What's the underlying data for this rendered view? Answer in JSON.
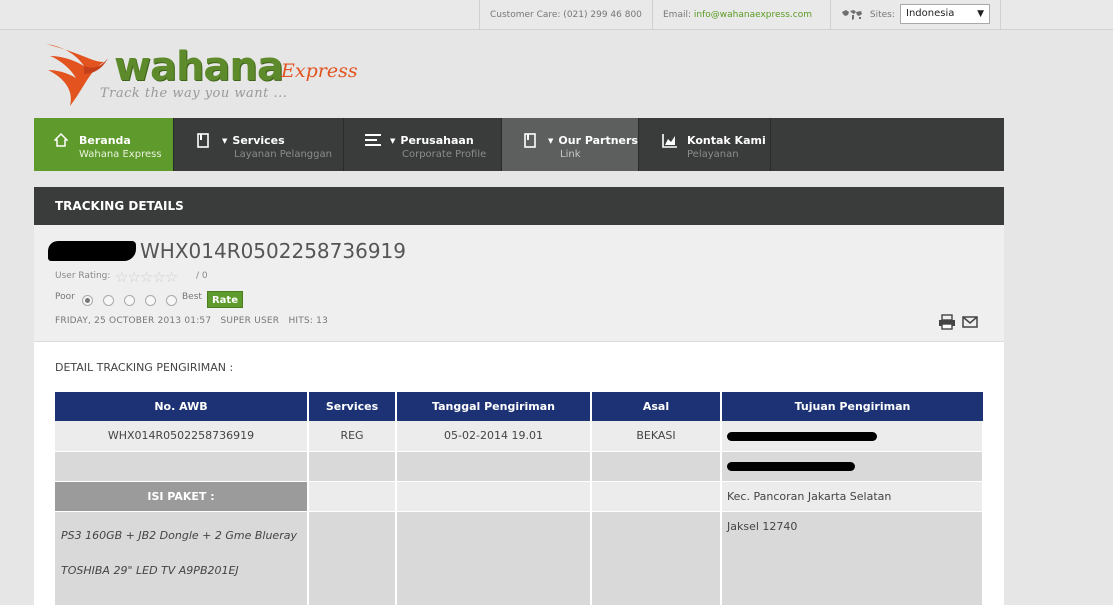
{
  "topbar": {
    "customer_care": "Customer Care: (021) 299 46 800",
    "email_label": "Email:",
    "email_value": "info@wahanaexpress.com",
    "sites_label": "Sites:",
    "site_selected": "Indonesia"
  },
  "logo": {
    "word": "wahana",
    "sub": "Express",
    "tagline": "Track the way you want ..."
  },
  "nav": [
    {
      "title": "Beranda",
      "sub": "Wahana Express",
      "icon": "home-icon"
    },
    {
      "title": "Services",
      "sub": "Layanan Pelanggan",
      "icon": "book-icon"
    },
    {
      "title": "Perusahaan",
      "sub": "Corporate Profile",
      "icon": "list-icon"
    },
    {
      "title": "Our Partners",
      "sub": "Link",
      "icon": "book-icon"
    },
    {
      "title": "Kontak Kami",
      "sub": "Pelayanan",
      "icon": "chart-icon"
    }
  ],
  "panel": {
    "heading": "TRACKING DETAILS",
    "doc_title": "WHX014R0502258736919",
    "user_rating_label": "User Rating:",
    "rating_count": "/ 0",
    "rate_poor": "Poor",
    "rate_best": "Best",
    "rate_button": "Rate",
    "meta_date": "FRIDAY, 25 OCTOBER 2013 01:57",
    "meta_author": "SUPER USER",
    "meta_hits": "HITS: 13"
  },
  "section_label": "DETAIL TRACKING PENGIRIMAN :",
  "table": {
    "headers": [
      "No. AWB",
      "Services",
      "Tanggal Pengiriman",
      "Asal",
      "Tujuan Pengiriman"
    ],
    "row1": {
      "awb": "WHX014R0502258736919",
      "service": "REG",
      "date": "05-02-2014 19.01",
      "origin": "BEKASI"
    },
    "isi_paket_label": "ISI PAKET :",
    "dest_line3": "Kec. Pancoran Jakarta Selatan",
    "dest_line4": "Jaksel 12740",
    "items": [
      "PS3 160GB + JB2 Dongle + 2 Gme Blueray",
      "TOSHIBA 29\" LED TV A9PB201EJ"
    ]
  },
  "colors": {
    "nav_active": "#5e9a2c",
    "header_blue": "#1c3275",
    "dark_bar": "#3a3b3b",
    "link_green": "#5a9b22",
    "logo_orange": "#e2531f"
  }
}
